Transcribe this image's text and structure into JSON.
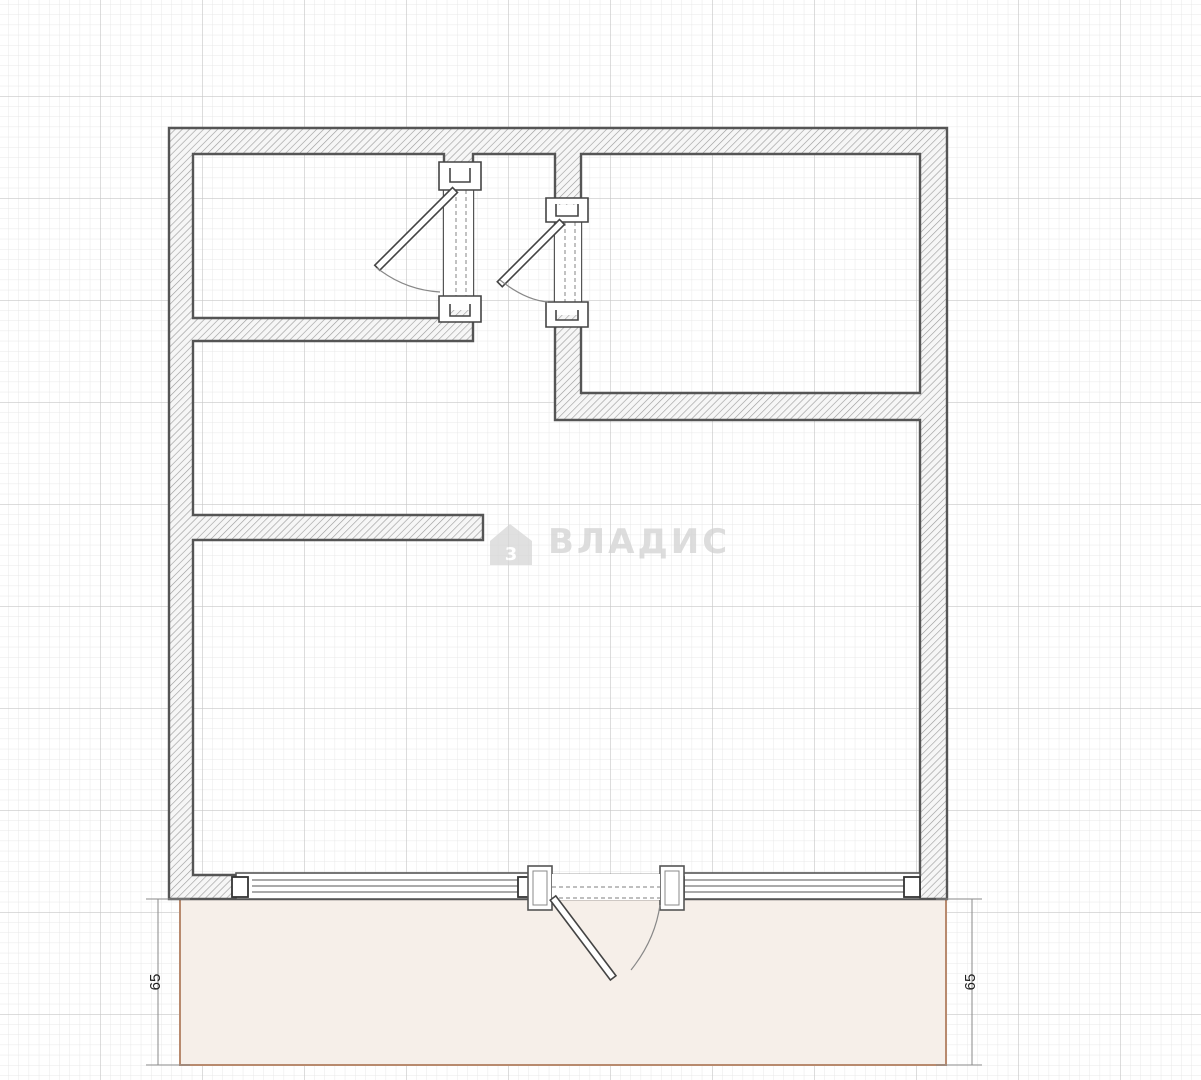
{
  "plan": {
    "watermark": {
      "text": "ВЛАДИС",
      "color": "#d2d2d2"
    },
    "dimensions": {
      "left_label": "65",
      "right_label": "65"
    },
    "colors": {
      "background": "#ffffff",
      "grid_minor": "#e8e8e8",
      "grid_major": "#c8c8c8",
      "wall_fill": "#f6f6f6",
      "wall_stroke": "#555555",
      "hatch": "#9a9a9a",
      "balcony_fill": "#f6efe9",
      "balcony_stroke": "#b88a6e",
      "dimension_line": "#8a8a8a"
    }
  }
}
